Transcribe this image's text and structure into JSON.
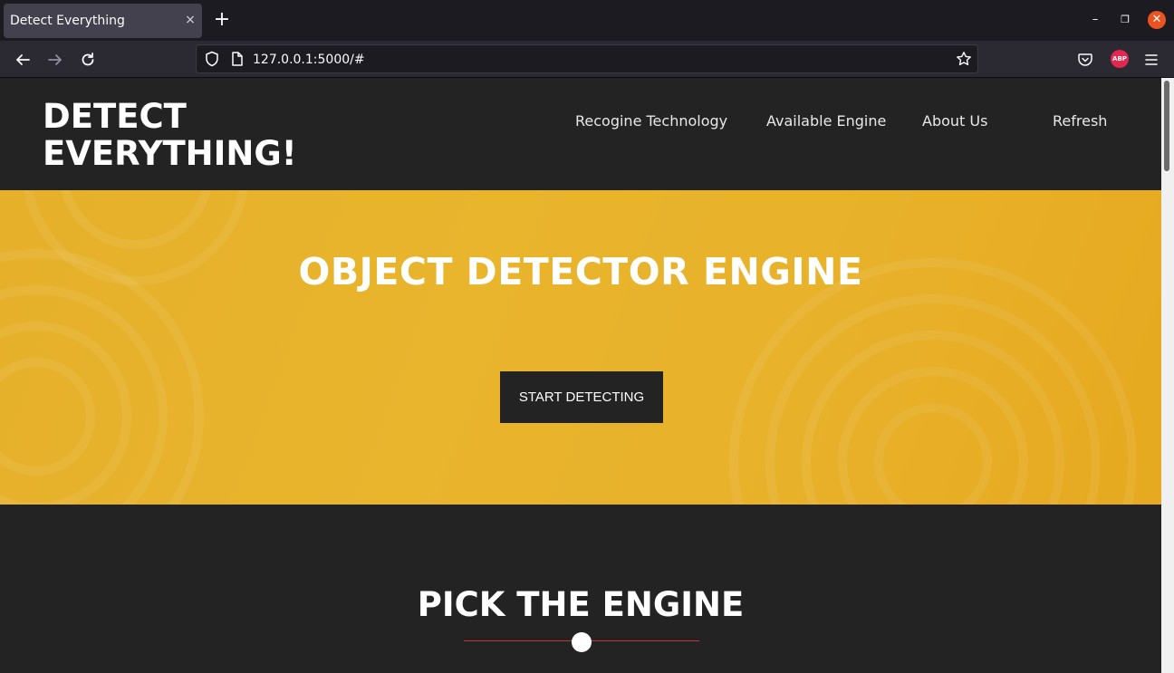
{
  "browser": {
    "tab_title": "Detect Everything",
    "tab_close": "×",
    "new_tab": "+",
    "url": "127.0.0.1:5000/#",
    "extension_label": "ABP",
    "window_minimize": "–",
    "window_maximize": "❐",
    "window_close": "✕"
  },
  "site": {
    "logo_line1": "DETECT",
    "logo_line2": "EVERYTHING!",
    "menu": [
      "Recogine Technology",
      "Available Engine",
      "About Us",
      "Refresh"
    ]
  },
  "hero": {
    "title": "OBJECT DETECTOR ENGINE",
    "button_label": "START DETECTING"
  },
  "section": {
    "title": "PICK THE ENGINE"
  },
  "colors": {
    "accent": "#e9b52d",
    "dark": "#232323",
    "divider": "#c0392b",
    "close_button": "#e95420"
  }
}
